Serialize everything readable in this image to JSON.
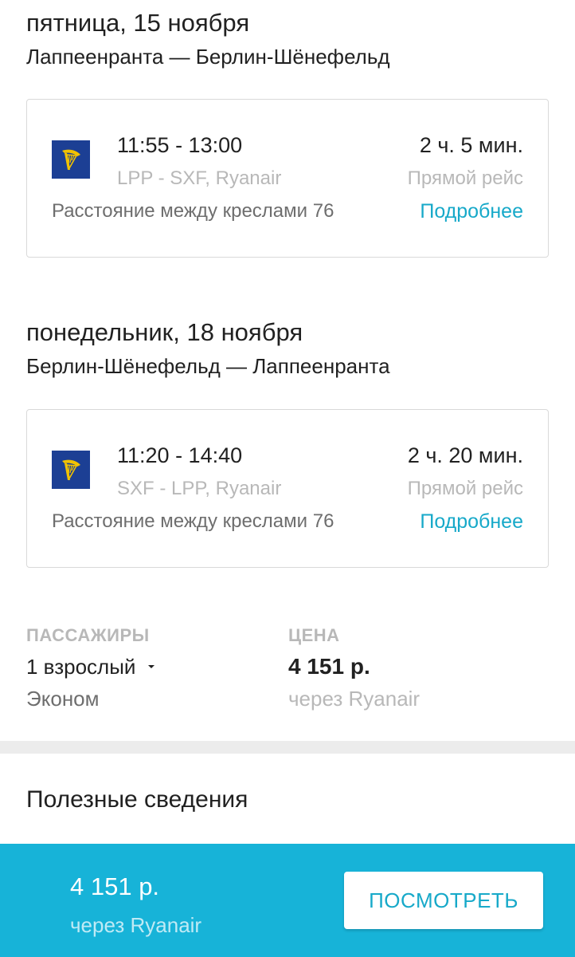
{
  "outbound": {
    "date": "пятница, 15 ноября",
    "route": "Лаппеенранта — Берлин-Шёнефельд",
    "time": "11:55 - 13:00",
    "duration": "2 ч. 5 мин.",
    "codes": "LPP - SXF, Ryanair",
    "flight_type": "Прямой рейс",
    "seat_pitch": "Расстояние между креслами 76",
    "details_link": "Подробнее",
    "airline_icon": "ryanair-harp-icon"
  },
  "return": {
    "date": "понедельник, 18 ноября",
    "route": "Берлин-Шёнефельд — Лаппеенранта",
    "time": "11:20 - 14:40",
    "duration": "2 ч. 20 мин.",
    "codes": "SXF - LPP, Ryanair",
    "flight_type": "Прямой рейс",
    "seat_pitch": "Расстояние между креслами 76",
    "details_link": "Подробнее",
    "airline_icon": "ryanair-harp-icon"
  },
  "passengers": {
    "label": "ПАССАЖИРЫ",
    "value": "1 взрослый",
    "class": "Эконом"
  },
  "price": {
    "label": "ЦЕНА",
    "value": "4 151 р.",
    "via": "через Ryanair"
  },
  "useful_info": {
    "title": "Полезные сведения"
  },
  "bottom_bar": {
    "price": "4 151 р.",
    "via": "через Ryanair",
    "button_label": "ПОСМОТРЕТЬ"
  },
  "colors": {
    "accent": "#17b3d8",
    "link": "#17a9c9",
    "airline_logo_bg": "#1c3f94",
    "airline_logo_fg": "#f2c200"
  }
}
